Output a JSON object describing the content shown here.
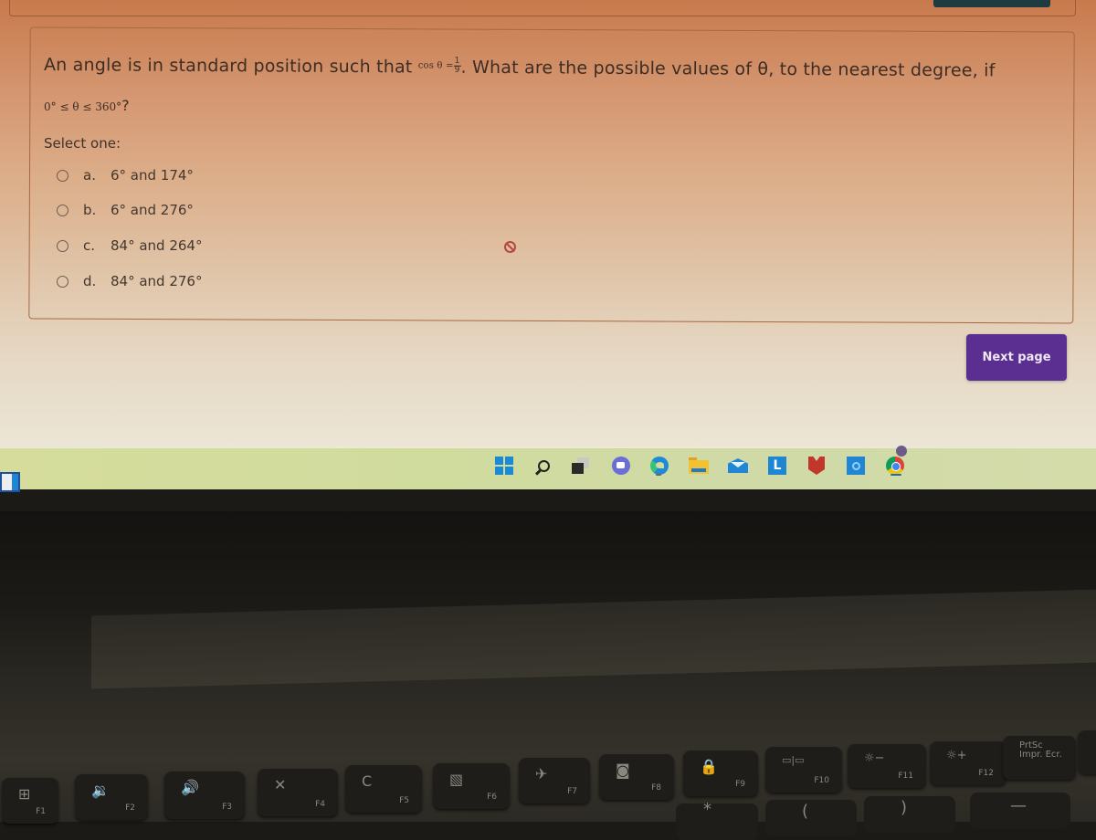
{
  "question": {
    "text_before": "An angle is in standard position such that ",
    "cos_label": "cos θ =",
    "fraction_numerator": "1",
    "fraction_denominator": "9",
    "text_after": ". What are the possible values of θ, to the nearest degree, if",
    "range": "0° ≤ θ ≤ 360°",
    "range_suffix": "?"
  },
  "select_one_label": "Select one:",
  "options": [
    {
      "letter": "a.",
      "text": "6° and 174°",
      "selected": false
    },
    {
      "letter": "b.",
      "text": "6° and 276°",
      "selected": false
    },
    {
      "letter": "c.",
      "text": "84° and 264°",
      "selected": false
    },
    {
      "letter": "d.",
      "text": "84° and 276°",
      "selected": false
    }
  ],
  "next_button": {
    "label": "Next page",
    "color": "#5a2f91"
  },
  "cursor": {
    "icon": "not-allowed-cursor-icon"
  },
  "taskbar": {
    "icons": [
      {
        "name": "windows-start-icon"
      },
      {
        "name": "search-icon"
      },
      {
        "name": "task-view-icon"
      },
      {
        "name": "teams-chat-icon"
      },
      {
        "name": "edge-browser-icon"
      },
      {
        "name": "file-explorer-icon"
      },
      {
        "name": "mail-icon"
      },
      {
        "name": "launcher-l-icon",
        "label": "L"
      },
      {
        "name": "mcafee-icon"
      },
      {
        "name": "cortana-icon"
      },
      {
        "name": "chrome-icon"
      }
    ]
  },
  "keyboard": {
    "function_keys": [
      {
        "glyph": "⊞",
        "label": "F1"
      },
      {
        "glyph": "🔉",
        "label": "F2"
      },
      {
        "glyph": "🔊",
        "label": "F3"
      },
      {
        "glyph": "✕",
        "label": "F4"
      },
      {
        "glyph": "C",
        "label": "F5"
      },
      {
        "glyph": "▧",
        "label": "F6"
      },
      {
        "glyph": "✈",
        "label": "F7"
      },
      {
        "glyph": "◙",
        "label": "F8"
      },
      {
        "glyph": "🔒",
        "label": "F9"
      },
      {
        "glyph": "▭|▭",
        "label": "F10"
      },
      {
        "glyph": "☼−",
        "label": "F11"
      },
      {
        "glyph": "☼+",
        "label": "F12"
      }
    ],
    "prtsc": {
      "line1": "PrtSc",
      "line2": "Impr. Ecr."
    },
    "row2": {
      "paren_open": "(",
      "paren_close": ")",
      "star": "*"
    }
  }
}
